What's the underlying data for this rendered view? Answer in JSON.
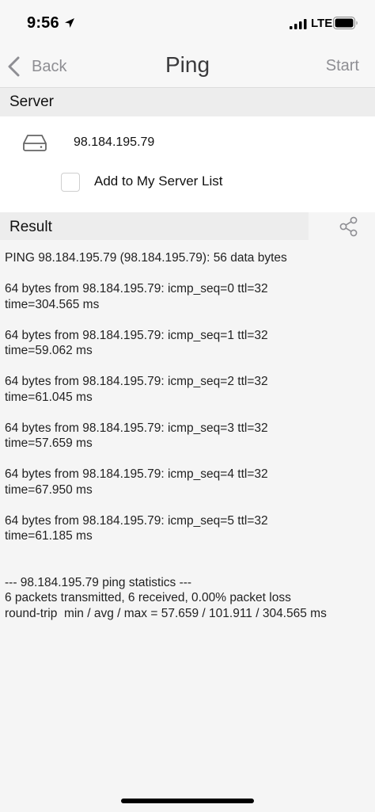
{
  "status_bar": {
    "time": "9:56",
    "network": "LTE",
    "icons": [
      "location-arrow-icon",
      "cellular-signal-icon",
      "battery-icon"
    ]
  },
  "nav": {
    "back_label": "Back",
    "title": "Ping",
    "start_label": "Start"
  },
  "server": {
    "section_label": "Server",
    "address": "98.184.195.79",
    "add_to_list_label": "Add to My Server List",
    "add_to_list_checked": false
  },
  "result": {
    "section_label": "Result",
    "output": "PING 98.184.195.79 (98.184.195.79): 56 data bytes\n\n64 bytes from 98.184.195.79: icmp_seq=0 ttl=32\ntime=304.565 ms\n\n64 bytes from 98.184.195.79: icmp_seq=1 ttl=32\ntime=59.062 ms\n\n64 bytes from 98.184.195.79: icmp_seq=2 ttl=32\ntime=61.045 ms\n\n64 bytes from 98.184.195.79: icmp_seq=3 ttl=32\ntime=57.659 ms\n\n64 bytes from 98.184.195.79: icmp_seq=4 ttl=32\ntime=67.950 ms\n\n64 bytes from 98.184.195.79: icmp_seq=5 ttl=32\ntime=61.185 ms\n\n\n--- 98.184.195.79 ping statistics ---\n6 packets transmitted, 6 received, 0.00% packet loss\nround-trip  min / avg / max = 57.659 / 101.911 / 304.565 ms"
  },
  "colors": {
    "bar_background": "#f7f7f7",
    "section_header": "#ededed",
    "result_background": "#f5f5f5",
    "muted_text": "#8e8e93"
  }
}
